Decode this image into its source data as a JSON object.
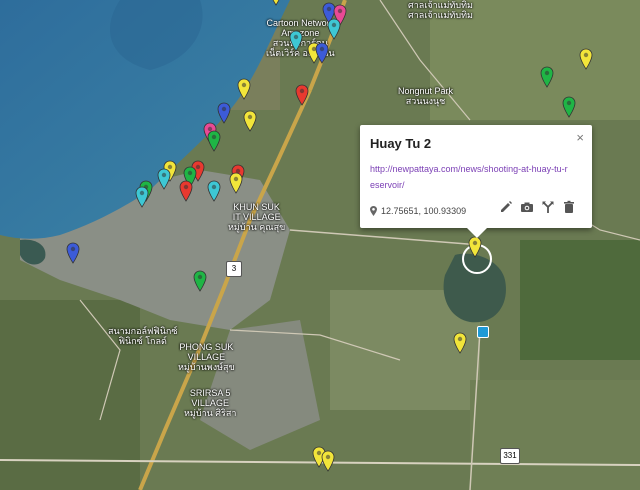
{
  "map_labels": {
    "cartoon_network_l1": "Cartoon Network",
    "cartoon_network_l2": "Amazone",
    "cartoon_network_th": "สวนน้ำการ์ตูน",
    "cartoon_network_th2": "เน็ตเวิร์ค อเมซอน",
    "top_right_th": "ศาลเจ้าแม่ทับทิม",
    "top_right_th2": "ศาลเจ้าแม่ทับทิม",
    "nongnut_park": "Nongnut Park",
    "nongnut_park_th": "สวนนงนุช",
    "khun_suk_l1": "KHUN SUK",
    "khun_suk_l2": "IT VILLAGE",
    "khun_suk_th": "หมู่บ้าน คุณสุข",
    "phong_suk_l1": "PHONG SUK",
    "phong_suk_l2": "VILLAGE",
    "phong_suk_th": "หมู่บ้านพงษ์สุข",
    "sirisa_l1": "SRIRSA 5",
    "sirisa_l2": "VILLAGE",
    "sirisa_th": "หมู่บ้าน ศิริสา",
    "park_th": "สนามกอล์ฟฟินิกซ์",
    "park_th2": "ฟินิกซ์ โกลด์",
    "route_3": "3",
    "route_331": "331"
  },
  "popup": {
    "title": "Huay Tu 2",
    "link": "http://newpattaya.com/news/shooting-at-huay-tu-reservoir/",
    "coords": "12.75651, 100.93309",
    "close_glyph": "×"
  },
  "colors": {
    "yellow": "#f2e53a",
    "red": "#e8392f",
    "green": "#1fb545",
    "blue": "#3c5bd8",
    "cyan": "#3ec7d4",
    "pink": "#e94a95"
  }
}
